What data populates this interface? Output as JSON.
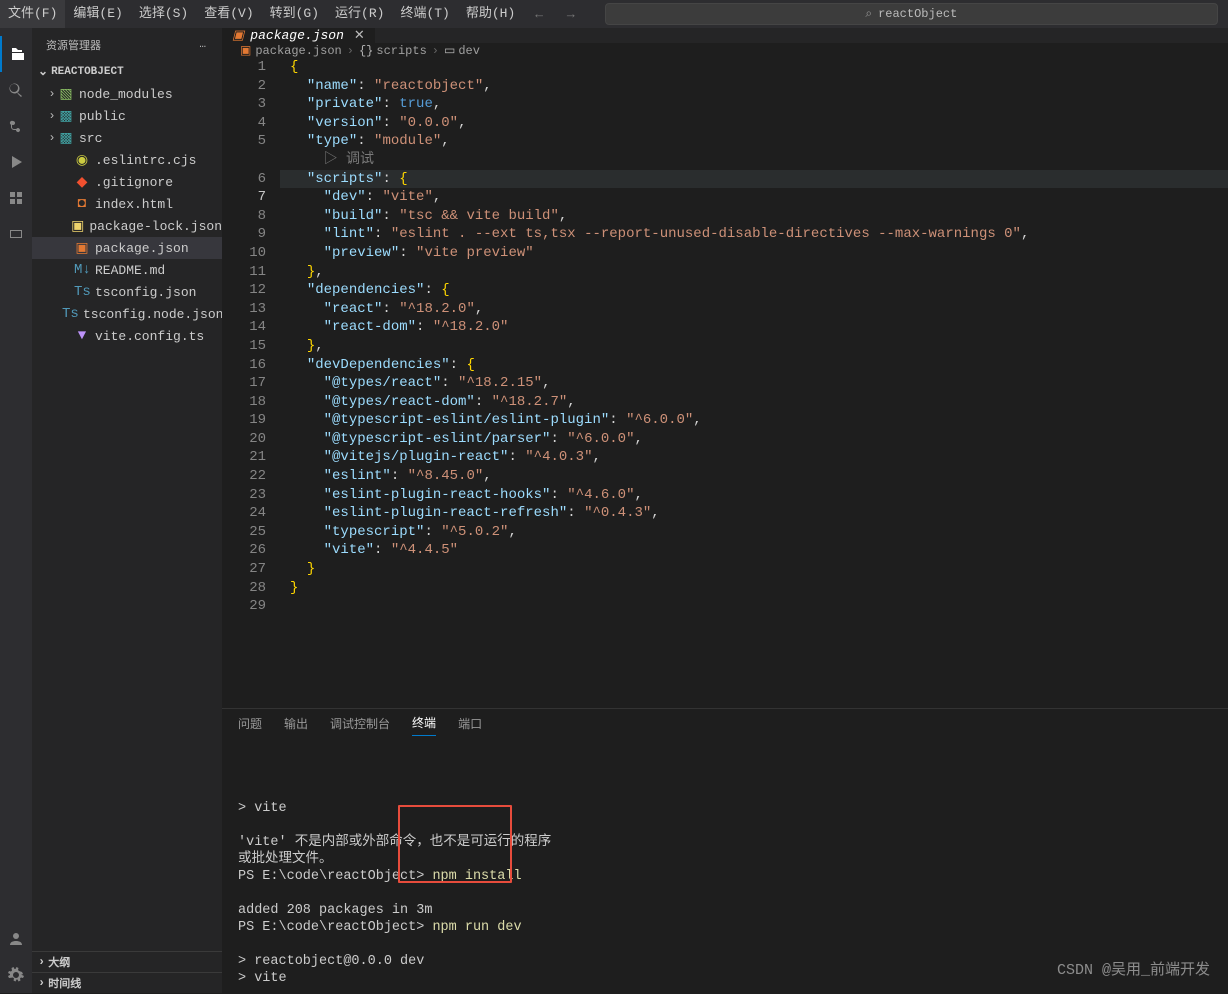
{
  "menu": {
    "items": [
      "文件(F)",
      "编辑(E)",
      "选择(S)",
      "查看(V)",
      "转到(G)",
      "运行(R)",
      "终端(T)",
      "帮助(H)"
    ]
  },
  "title_search": "reactObject",
  "sidebar": {
    "title": "资源管理器",
    "section": "REACTOBJECT",
    "files": [
      {
        "kind": "folder",
        "name": "node_modules",
        "iconClass": "node_modules"
      },
      {
        "kind": "folder",
        "name": "public",
        "iconClass": "public"
      },
      {
        "kind": "folder",
        "name": "src",
        "iconClass": "src"
      },
      {
        "kind": "file",
        "name": ".eslintrc.cjs",
        "iconClass": "js"
      },
      {
        "kind": "file",
        "name": ".gitignore",
        "iconClass": "git"
      },
      {
        "kind": "file",
        "name": "index.html",
        "iconClass": "html"
      },
      {
        "kind": "file",
        "name": "package-lock.json",
        "iconClass": "json"
      },
      {
        "kind": "file",
        "name": "package.json",
        "iconClass": "pkg",
        "selected": true
      },
      {
        "kind": "file",
        "name": "README.md",
        "iconClass": "md"
      },
      {
        "kind": "file",
        "name": "tsconfig.json",
        "iconClass": "ts"
      },
      {
        "kind": "file",
        "name": "tsconfig.node.json",
        "iconClass": "ts"
      },
      {
        "kind": "file",
        "name": "vite.config.ts",
        "iconClass": "vite"
      }
    ],
    "collapsed": [
      "大纲",
      "时间线"
    ]
  },
  "tab": {
    "label": "package.json"
  },
  "breadcrumb": {
    "items": [
      "package.json",
      "scripts",
      "dev"
    ]
  },
  "code": {
    "package_json": {
      "name": "reactobject",
      "private": true,
      "version": "0.0.0",
      "type": "module",
      "debug_hint": "调试",
      "scripts": {
        "dev": "vite",
        "build": "tsc && vite build",
        "lint": "eslint . --ext ts,tsx --report-unused-disable-directives --max-warnings 0",
        "preview": "vite preview"
      },
      "dependencies": {
        "react": "^18.2.0",
        "react-dom": "^18.2.0"
      },
      "devDependencies": {
        "@types/react": "^18.2.15",
        "@types/react-dom": "^18.2.7",
        "@typescript-eslint/eslint-plugin": "^6.0.0",
        "@typescript-eslint/parser": "^6.0.0",
        "@vitejs/plugin-react": "^4.0.3",
        "eslint": "^8.45.0",
        "eslint-plugin-react-hooks": "^4.6.0",
        "eslint-plugin-react-refresh": "^0.4.3",
        "typescript": "^5.0.2",
        "vite": "^4.4.5"
      }
    },
    "line_count": 29,
    "active_line": 7
  },
  "panel": {
    "tabs": [
      "问题",
      "输出",
      "调试控制台",
      "终端",
      "端口"
    ],
    "active": 3
  },
  "terminal": {
    "lines": [
      {
        "t": "> vite"
      },
      {
        "t": ""
      },
      {
        "t": "'vite' 不是内部或外部命令，也不是可运行的程序"
      },
      {
        "t": "或批处理文件。"
      },
      {
        "prompt": "PS E:\\code\\reactObject> ",
        "cmd": "npm install"
      },
      {
        "t": ""
      },
      {
        "t": "added 208 packages in 3m"
      },
      {
        "prompt": "PS E:\\code\\reactObject> ",
        "cmd": "npm run dev"
      },
      {
        "t": ""
      },
      {
        "t": "> reactobject@0.0.0 dev"
      },
      {
        "t": "> vite"
      }
    ]
  },
  "watermark": "CSDN @吴用_前端开发"
}
